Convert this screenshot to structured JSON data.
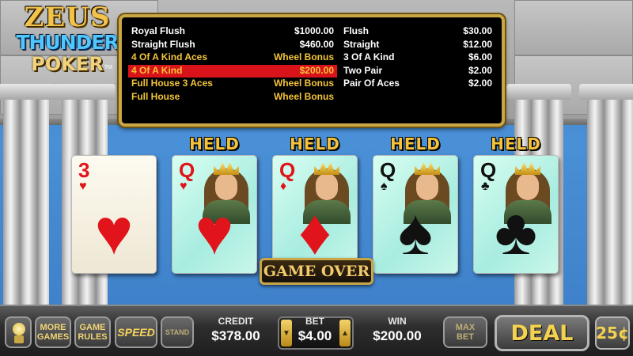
{
  "logo": {
    "line1": "ZEUS",
    "line2": "THUNDER",
    "line3": "POKER",
    "tm": "TM"
  },
  "paytable": {
    "left": [
      {
        "hand": "Royal Flush",
        "pay": "$1000.00",
        "style": ""
      },
      {
        "hand": "Straight Flush",
        "pay": "$460.00",
        "style": ""
      },
      {
        "hand": "4 Of A Kind Aces",
        "pay": "Wheel Bonus",
        "style": "gold"
      },
      {
        "hand": "4 Of A Kind",
        "pay": "$200.00",
        "style": "active"
      },
      {
        "hand": "Full House 3 Aces",
        "pay": "Wheel Bonus",
        "style": "gold"
      },
      {
        "hand": "Full House",
        "pay": "Wheel Bonus",
        "style": "gold"
      }
    ],
    "right": [
      {
        "hand": "Flush",
        "pay": "$30.00",
        "style": ""
      },
      {
        "hand": "Straight",
        "pay": "$12.00",
        "style": ""
      },
      {
        "hand": "3 Of A Kind",
        "pay": "$6.00",
        "style": ""
      },
      {
        "hand": "Two Pair",
        "pay": "$2.00",
        "style": ""
      },
      {
        "hand": "Pair Of Aces",
        "pay": "$2.00",
        "style": ""
      }
    ]
  },
  "cards": [
    {
      "rank": "3",
      "suit": "♥",
      "color": "red",
      "held": false,
      "face": false
    },
    {
      "rank": "Q",
      "suit": "♥",
      "color": "red",
      "held": true,
      "face": true
    },
    {
      "rank": "Q",
      "suit": "♦",
      "color": "red",
      "held": true,
      "face": true
    },
    {
      "rank": "Q",
      "suit": "♠",
      "color": "blk",
      "held": true,
      "face": true
    },
    {
      "rank": "Q",
      "suit": "♣",
      "color": "blk",
      "held": true,
      "face": true
    }
  ],
  "held_label": "HELD",
  "game_over": "GAME OVER",
  "controls": {
    "more_games": [
      "MORE",
      "GAMES"
    ],
    "game_rules": [
      "GAME",
      "RULES"
    ],
    "speed": "SPEED",
    "stand": "STAND",
    "credit_label": "CREDIT",
    "credit_value": "$378.00",
    "bet_label": "BET",
    "bet_value": "$4.00",
    "win_label": "WIN",
    "win_value": "$200.00",
    "max_bet": [
      "MAX",
      "BET"
    ],
    "deal": "DEAL",
    "denomination": "25¢"
  }
}
